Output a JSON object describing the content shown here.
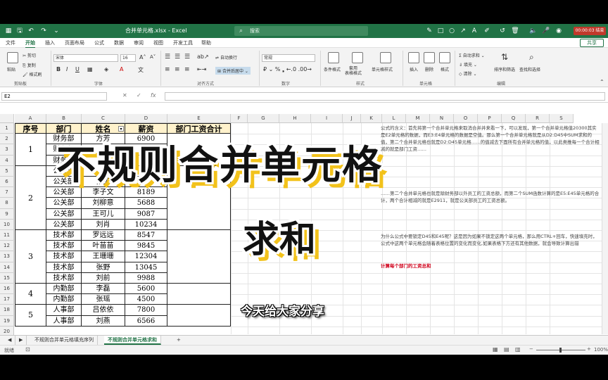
{
  "titlebar": {
    "title": "合并单元格.xlsx - Excel",
    "search_placeholder": "搜索",
    "recording": "00:00:03 结束"
  },
  "menu": {
    "items": [
      "文件",
      "开始",
      "插入",
      "页面布局",
      "公式",
      "数据",
      "审阅",
      "视图",
      "开发工具",
      "帮助"
    ],
    "active": "开始",
    "share": "共享"
  },
  "ribbon": {
    "font_name": "宋体",
    "font_size": "16",
    "bold": "B",
    "italic": "I",
    "underline": "U",
    "clipboard": {
      "paste": "粘贴",
      "cut": "剪切",
      "copy": "复制",
      "format_painter": "格式刷",
      "label": "剪贴板"
    },
    "font_label": "字体",
    "alignment": {
      "wrap": "自动换行",
      "merge": "合并后居中",
      "label": "对齐方式"
    },
    "number": {
      "format": "常规",
      "label": "数字"
    },
    "styles": {
      "conditional": "条件格式",
      "table": "套用\n表格格式",
      "cell_styles": "单元格样式",
      "label": "样式"
    },
    "cells": {
      "insert": "插入",
      "delete": "删除",
      "format": "格式",
      "label": "单元格"
    },
    "editing": {
      "autosum": "自动求和",
      "fill": "填充",
      "clear": "清除",
      "sort": "排序和筛选",
      "find": "查找和选择",
      "label": "编辑"
    }
  },
  "formula_bar": {
    "name_box": "E2",
    "fx": "fx",
    "content": ""
  },
  "columns": [
    "A",
    "B",
    "C",
    "D",
    "E",
    "F",
    "G",
    "H",
    "I",
    "J",
    "K",
    "L",
    "M",
    "N",
    "O",
    "P",
    "Q",
    "R",
    "S"
  ],
  "rows": [
    "1",
    "2",
    "3",
    "4",
    "5",
    "6",
    "7",
    "8",
    "9",
    "10",
    "11",
    "12",
    "13",
    "14",
    "15",
    "16",
    "17",
    "18",
    "19",
    "20",
    "21"
  ],
  "table": {
    "headers": [
      "序号",
      "部门",
      "姓名",
      "薪资",
      "部门工资合计"
    ],
    "groups": [
      {
        "id": "1",
        "rows": [
          [
            "财务部",
            "方芳",
            "6900"
          ],
          [
            "财务部",
            "",
            ""
          ],
          [
            "财务部",
            "",
            ""
          ]
        ]
      },
      {
        "id": "2",
        "rows": [
          [
            "公关部",
            "",
            ""
          ],
          [
            "公关部",
            "张荚",
            ""
          ],
          [
            "公关部",
            "李子文",
            "8189"
          ],
          [
            "公关部",
            "刘柳意",
            "5688"
          ],
          [
            "公关部",
            "王可儿",
            "9087"
          ],
          [
            "公关部",
            "刘肖",
            "10234"
          ]
        ]
      },
      {
        "id": "3",
        "rows": [
          [
            "技术部",
            "罗远远",
            "8547"
          ],
          [
            "技术部",
            "叶苗苗",
            "9845"
          ],
          [
            "技术部",
            "王珊珊",
            "12304"
          ],
          [
            "技术部",
            "张野",
            "13045"
          ],
          [
            "技术部",
            "刘前",
            "9988"
          ]
        ]
      },
      {
        "id": "4",
        "rows": [
          [
            "内勤部",
            "李磊",
            "5600"
          ],
          [
            "内勤部",
            "张瑶",
            "4500"
          ]
        ]
      },
      {
        "id": "5",
        "rows": [
          [
            "人事部",
            "吕依依",
            "7800"
          ],
          [
            "人事部",
            "刘燕",
            "6566"
          ]
        ]
      }
    ]
  },
  "notes": {
    "p1": "公式的含义：首先将第一个合并单元格来取消合并并来看一下，可以发现，第一个合并单元格值20300其实是E2单元格的数据，而E3:E4单元格的数据是空值。那么第一个合并单元格就是从D2:D45中SUM求和的值，第二个合并单元格也就是D2:D45单元格……的值减去下面所有合并单元格的值，以此类推每一个合计相减的就是部门工资……",
    "p2": "……第二个合并单元格也就是除财务部以外员工的工资总额，而第二个SUM函数计算的是E5:E45单元格的合计，两个合计相减的就是E2911，就是公关部员工的工资总额。",
    "p3": "为什么公式中要锁定D45和E45呢？这是因为如果不锁定这两个单元格，那么用CTRL+回车，快速填充时，公式中这两个单元格会随着表格位置的变化而变化,如果表格下方还有其他数据，就会导致计算出错",
    "red": "计算每个部门的工资总和"
  },
  "overlay": {
    "title_line1": "不规则合并单元格",
    "title_line2": "求和",
    "subtitle": "今天给大家分享"
  },
  "sheets": {
    "tabs": [
      "不规则合并单元格填充序列",
      "不规则合并单元格求和"
    ],
    "active": "不规则合并单元格求和",
    "add": "+"
  },
  "status": {
    "ready": "就绪",
    "zoom": "100%"
  }
}
